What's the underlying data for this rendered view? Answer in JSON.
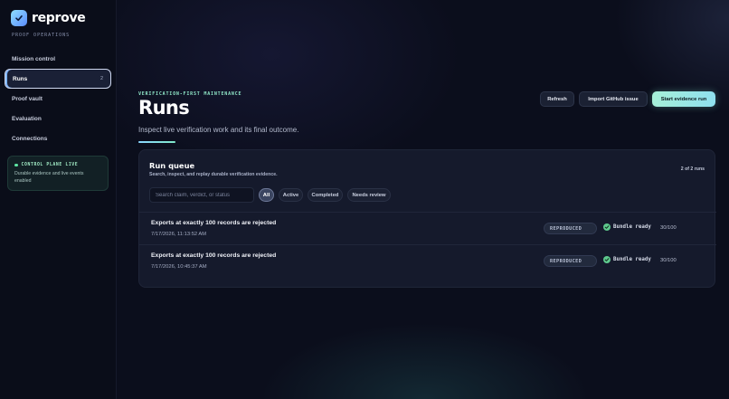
{
  "brand": {
    "name": "reprove",
    "subtitle": "PROOF OPERATIONS"
  },
  "sidebar": {
    "items": [
      {
        "label": "Mission control"
      },
      {
        "label": "Runs",
        "count": "2",
        "active": true
      },
      {
        "label": "Proof vault"
      },
      {
        "label": "Evaluation"
      },
      {
        "label": "Connections"
      }
    ],
    "status_card": {
      "title": "CONTROL PLANE LIVE",
      "description": "Durable evidence and live events enabled"
    }
  },
  "header": {
    "eyebrow": "VERIFICATION-FIRST MAINTENANCE",
    "title": "Runs",
    "description": "Inspect live verification work and its final outcome.",
    "buttons": {
      "refresh": "Refresh",
      "import": "Import GitHub issue",
      "start": "Start evidence run"
    }
  },
  "queue": {
    "title": "Run queue",
    "subtitle": "Search, inspect, and replay durable verification evidence.",
    "count": "2 of 2 runs",
    "search_placeholder": "Search claim, verdict, or status",
    "filters": [
      {
        "label": "All",
        "active": true
      },
      {
        "label": "Active"
      },
      {
        "label": "Completed"
      },
      {
        "label": "Needs review"
      }
    ],
    "runs": [
      {
        "title": "Exports at exactly 100 records are rejected",
        "timestamp": "7/17/2026, 11:13:52 AM",
        "verdict": "REPRODUCED",
        "bundle": "Bundle ready",
        "score": "30/100"
      },
      {
        "title": "Exports at exactly 100 records are rejected",
        "timestamp": "7/17/2026, 10:45:37 AM",
        "verdict": "REPRODUCED",
        "bundle": "Bundle ready",
        "score": "30/100"
      }
    ]
  },
  "colors": {
    "background": "#0b0e1c",
    "accent": "#8fe6c7",
    "success": "#5ec98d"
  }
}
